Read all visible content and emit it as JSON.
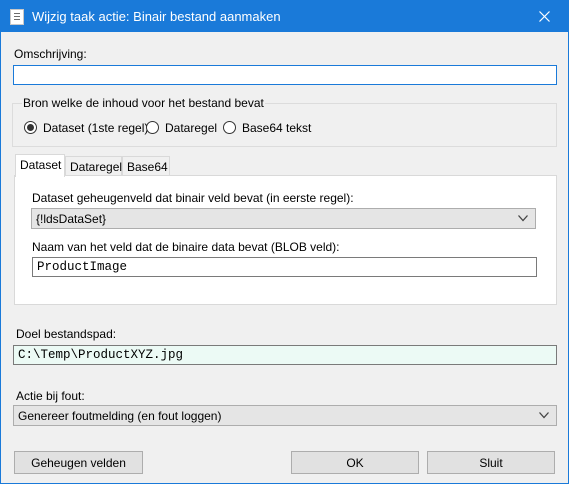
{
  "window": {
    "title": "Wijzig taak actie: Binair bestand aanmaken"
  },
  "description": {
    "label": "Omschrijving:",
    "value": ""
  },
  "source": {
    "group_title": "Bron welke de inhoud voor het bestand bevat",
    "options": [
      {
        "label": "Dataset (1ste regel)",
        "selected": true
      },
      {
        "label": "Dataregel",
        "selected": false
      },
      {
        "label": "Base64 tekst",
        "selected": false
      }
    ]
  },
  "tabs": [
    {
      "label": "Dataset",
      "active": true
    },
    {
      "label": "Dataregel",
      "active": false
    },
    {
      "label": "Base64",
      "active": false
    }
  ],
  "dataset_tab": {
    "memfield_label": "Dataset geheugenveld dat binair veld bevat (in eerste regel):",
    "memfield_value": "{!ldsDataSet}",
    "blobfield_label": "Naam van het veld dat de binaire data bevat (BLOB veld):",
    "blobfield_value": "ProductImage"
  },
  "target": {
    "label": "Doel bestandspad:",
    "value": "C:\\Temp\\ProductXYZ.jpg",
    "field_color": "#ecfaf5"
  },
  "error_action": {
    "label": "Actie bij fout:",
    "value": "Genereer foutmelding (en fout loggen)"
  },
  "buttons": {
    "memory_fields": "Geheugen velden",
    "ok": "OK",
    "close": "Sluit"
  },
  "colors": {
    "titlebar": "#1a7ad9",
    "dialog_bg": "#f0f0f0"
  }
}
